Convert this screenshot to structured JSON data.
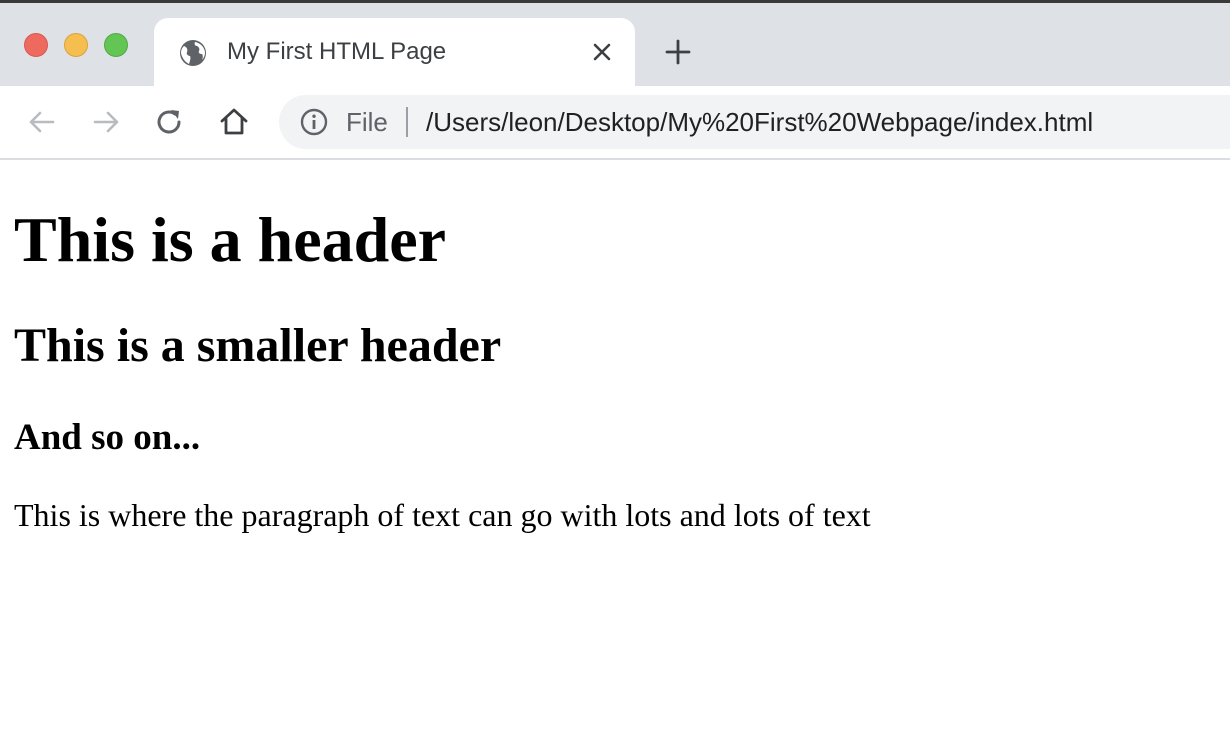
{
  "window": {
    "traffic_lights": {
      "close_color": "#ee6a5f",
      "minimize_color": "#f5be4f",
      "maximize_color": "#62c554"
    }
  },
  "tabs": [
    {
      "title": "My First HTML Page",
      "icon": "globe-icon",
      "active": true
    }
  ],
  "toolbar": {
    "back_icon": "arrow-left-icon",
    "forward_icon": "arrow-right-icon",
    "reload_icon": "reload-icon",
    "home_icon": "home-icon"
  },
  "omnibox": {
    "info_icon": "info-icon",
    "scheme_label": "File",
    "url": "/Users/leon/Desktop/My%20First%20Webpage/index.html"
  },
  "page": {
    "h1": "This is a header",
    "h2": "This is a smaller header",
    "h3": "And so on...",
    "paragraph": "This is where the paragraph of text can go with lots and lots of text"
  },
  "colors": {
    "tabstrip_bg": "#dee1e6",
    "omnibox_bg": "#f1f3f4",
    "text_primary": "#202124",
    "text_secondary": "#5f6368"
  }
}
